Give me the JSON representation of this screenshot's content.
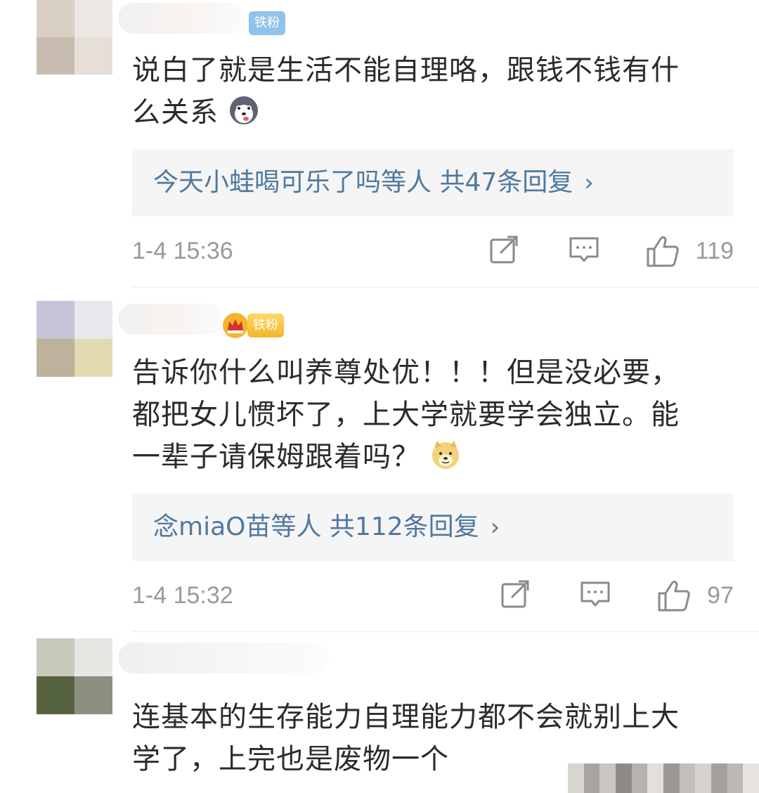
{
  "comments": [
    {
      "badge": "铁粉",
      "text_line1": "说白了就是生活不能自理咯，跟钱不钱有什",
      "text_line2": "么关系",
      "emoji": "husky-emoji",
      "replies_text": "今天小蛙喝可乐了吗等人  共47条回复",
      "time": "1-4 15:36",
      "likes": "119"
    },
    {
      "badge": "铁粉",
      "text_line1": "告诉你什么叫养尊处优！！！但是没必要，",
      "text_line2": "都把女儿惯坏了，上大学就要学会独立。能",
      "text_line3": "一辈子请保姆跟着吗？",
      "emoji": "doge-emoji",
      "replies_text": "念miaO苗等人  共112条回复",
      "time": "1-4 15:32",
      "likes": "97"
    },
    {
      "text_line1": "连基本的生存能力自理能力都不会就别上大",
      "text_line2": "学了，上完也是废物一个"
    }
  ],
  "icons": {
    "share": "share-icon",
    "comment": "comment-icon",
    "like": "thumbs-up-icon",
    "chevron": "chevron-right-icon"
  },
  "colors": {
    "link": "#50799f",
    "meta": "#9a9a9a",
    "text": "#2b2b2b",
    "reply_bg": "#f5f5f5",
    "badge_blue": "#8fc3ea",
    "badge_gold": "#f4b52c"
  }
}
